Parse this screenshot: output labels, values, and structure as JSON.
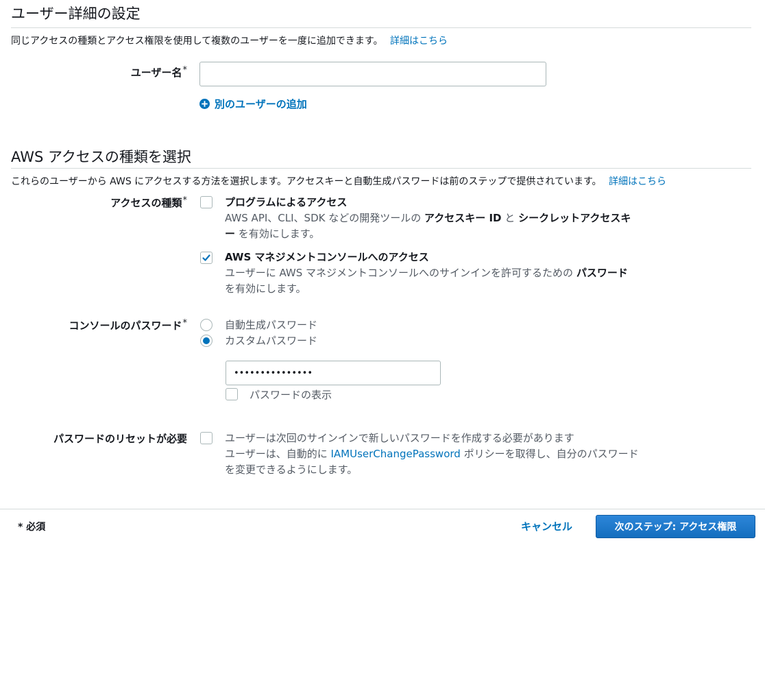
{
  "section1": {
    "title": "ユーザー詳細の設定",
    "description": "同じアクセスの種類とアクセス権限を使用して複数のユーザーを一度に追加できます。",
    "learn_more": "詳細はこちら",
    "username_label": "ユーザー名",
    "required_mark": "*",
    "username_value": "",
    "add_user_label": "別のユーザーの追加"
  },
  "section2": {
    "title": "AWS アクセスの種類を選択",
    "description": "これらのユーザーから AWS にアクセスする方法を選択します。アクセスキーと自動生成パスワードは前のステップで提供されています。",
    "learn_more": "詳細はこちら",
    "access_type_label": "アクセスの種類",
    "programmatic": {
      "title": "プログラムによるアクセス",
      "desc_1": "AWS API、CLI、SDK などの開発ツールの ",
      "desc_bold_1": "アクセスキー ID",
      "desc_2": " と ",
      "desc_bold_2": "シークレットアクセスキー",
      "desc_3": " を有効にします。",
      "checked": false
    },
    "console": {
      "title": "AWS マネジメントコンソールへのアクセス",
      "desc_1": "ユーザーに AWS マネジメントコンソールへのサインインを許可するための ",
      "desc_bold_1": "パスワード",
      "desc_2": " を有効にします。",
      "checked": true
    },
    "console_password_label": "コンソールのパスワード",
    "password_options": [
      {
        "label": "自動生成パスワード",
        "selected": false
      },
      {
        "label": "カスタムパスワード",
        "selected": true
      }
    ],
    "password_value": "•••••••••••••••",
    "show_password_label": "パスワードの表示",
    "reset_label": "パスワードのリセットが必要",
    "reset": {
      "title": "ユーザーは次回のサインインで新しいパスワードを作成する必要があります",
      "desc_1": "ユーザーは、自動的に ",
      "policy_link": "IAMUserChangePassword",
      "desc_2": " ポリシーを取得し、自分のパスワードを変更できるようにします。",
      "checked": false
    }
  },
  "footer": {
    "required_note": "* 必須",
    "cancel_label": "キャンセル",
    "next_label": "次のステップ: アクセス権限"
  },
  "colors": {
    "link": "#0073bb",
    "primary_button": "#1a73c8",
    "checkbox_selected": "#0073bb",
    "rule": "#d5dbdb"
  }
}
